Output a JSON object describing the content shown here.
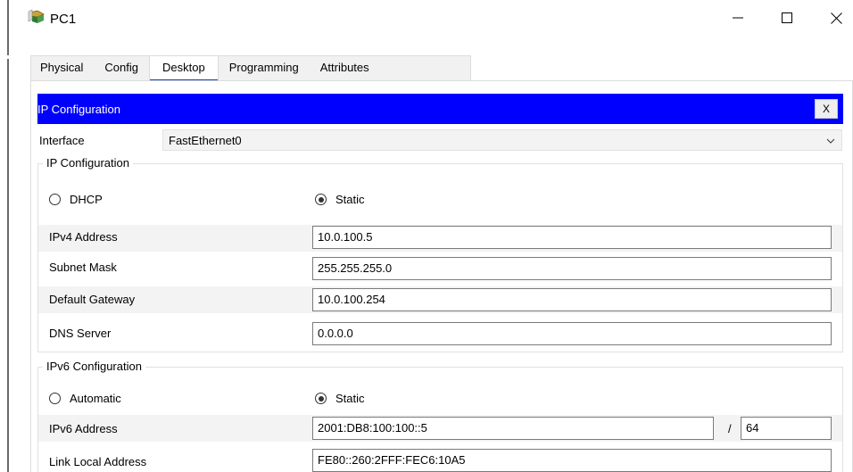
{
  "window": {
    "title": "PC1"
  },
  "tabs": [
    {
      "label": "Physical"
    },
    {
      "label": "Config"
    },
    {
      "label": "Desktop"
    },
    {
      "label": "Programming"
    },
    {
      "label": "Attributes"
    }
  ],
  "active_tab": "Desktop",
  "ip_config": {
    "header_title": "IP Configuration",
    "close_label": "X",
    "interface_label": "Interface",
    "interface_value": "FastEthernet0",
    "ipv4": {
      "legend": "IP Configuration",
      "dhcp_label": "DHCP",
      "static_label": "Static",
      "mode": "Static",
      "fields": [
        {
          "label": "IPv4 Address",
          "value": "10.0.100.5"
        },
        {
          "label": "Subnet Mask",
          "value": "255.255.255.0"
        },
        {
          "label": "Default Gateway",
          "value": "10.0.100.254"
        },
        {
          "label": "DNS Server",
          "value": "0.0.0.0"
        }
      ]
    },
    "ipv6": {
      "legend": "IPv6 Configuration",
      "auto_label": "Automatic",
      "static_label": "Static",
      "mode": "Static",
      "address_label": "IPv6 Address",
      "address_value": "2001:DB8:100:100::5",
      "prefix_separator": "/",
      "prefix_value": "64",
      "link_local_label": "Link Local Address",
      "link_local_value": "FE80::260:2FFF:FEC6:10A5"
    }
  },
  "colors": {
    "header_blue": "#0000ff",
    "tab_underline": "#1f3fb8"
  },
  "icons": {
    "app": "packet-tracer-pc-icon",
    "minimize": "minimize-icon",
    "maximize": "maximize-icon",
    "close": "close-icon",
    "dropdown": "chevron-down-icon"
  }
}
